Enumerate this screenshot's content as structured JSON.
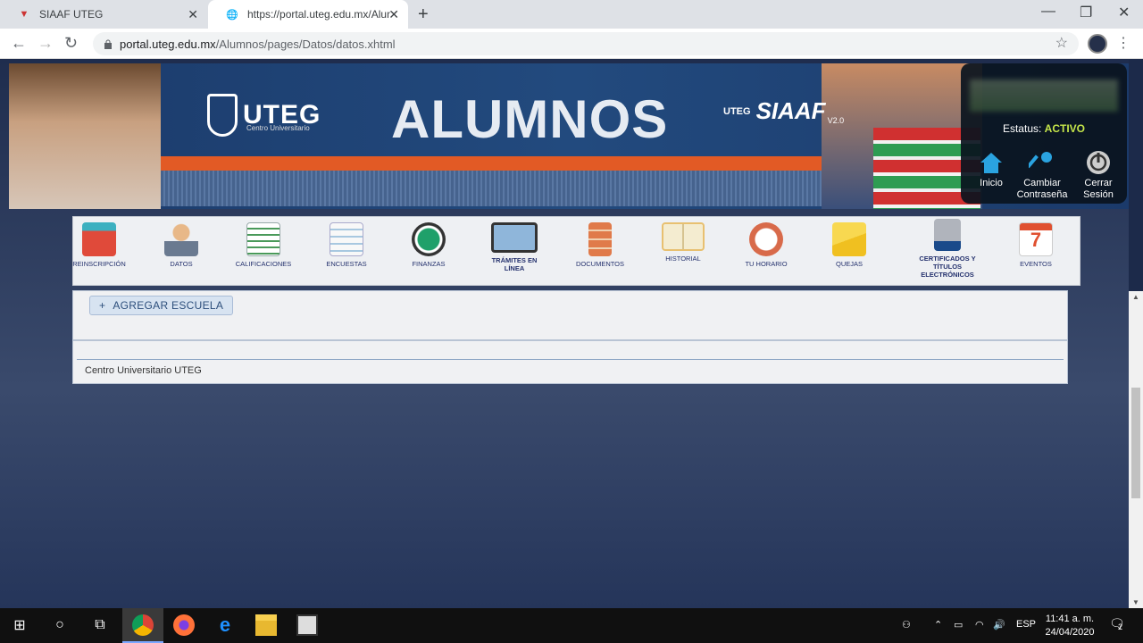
{
  "browser": {
    "tabs": [
      {
        "title": "SIAAF UTEG",
        "active": false
      },
      {
        "title": "https://portal.uteg.edu.mx/Alumnos/pages/Datos/datos.xhtml",
        "active": true
      }
    ],
    "url_host": "portal.uteg.edu.mx",
    "url_path": "/Alumnos/pages/Datos/datos.xhtml"
  },
  "banner": {
    "brand": "UTEG",
    "brand_sub": "Centro Universitario",
    "title": "ALUMNOS",
    "siaaf_prefix": "UTEG",
    "siaaf_name": "SIAAF",
    "siaaf_version": "V2.0"
  },
  "user": {
    "status_label": "Estatus:",
    "status_value": "ACTIVO",
    "actions": [
      {
        "label": "Inicio",
        "icon": "home-icon"
      },
      {
        "label": "Cambiar Contraseña",
        "icon": "key-icon"
      },
      {
        "label": "Cerrar Sesión",
        "icon": "power-icon"
      }
    ]
  },
  "menu": [
    {
      "label": "REINSCRIPCIÓN",
      "icon": "briefcase-icon",
      "color": "#e04a3a"
    },
    {
      "label": "DATOS",
      "icon": "user-icon",
      "color": "#7a8aa0"
    },
    {
      "label": "CALIFICACIONES",
      "icon": "grades-icon",
      "color": "#4a9a5a"
    },
    {
      "label": "ENCUESTAS",
      "icon": "checklist-icon",
      "color": "#a8c8e0"
    },
    {
      "label": "FINANZAS",
      "icon": "money-icon",
      "color": "#1fa06a"
    },
    {
      "label": "TRÁMITES EN LÍNEA",
      "icon": "laptop-icon",
      "color": "#3a5a8a"
    },
    {
      "label": "DOCUMENTOS",
      "icon": "books-icon",
      "color": "#e07a4a"
    },
    {
      "label": "HISTORIAL",
      "icon": "open-book-icon",
      "color": "#e8c070"
    },
    {
      "label": "TU HORARIO",
      "icon": "alarm-clock-icon",
      "color": "#d86a4a"
    },
    {
      "label": "QUEJAS",
      "icon": "envelope-icon",
      "color": "#f0c020"
    },
    {
      "label": "CERTIFICADOS Y TÍTULOS ELECTRÓNICOS",
      "icon": "download-doc-icon",
      "color": "#1a4a8a"
    },
    {
      "label": "EVENTOS",
      "icon": "calendar-icon",
      "color": "#e05030"
    }
  ],
  "calendar_day": "7",
  "content": {
    "add_button": "AGREGAR ESCUELA",
    "institution": "Centro Universitario UTEG"
  },
  "taskbar": {
    "lang": "ESP",
    "time": "11:41 a. m.",
    "date": "24/04/2020",
    "notifications": "2"
  }
}
